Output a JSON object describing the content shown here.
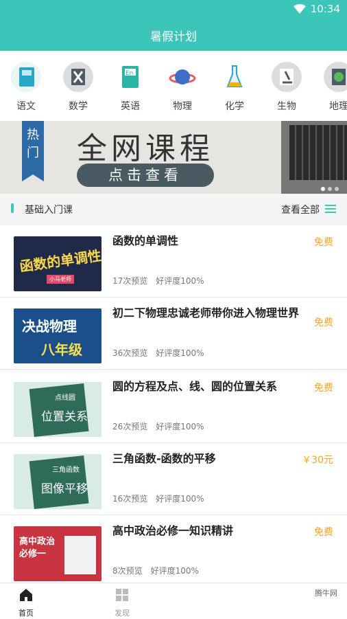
{
  "status": {
    "time": "10:34"
  },
  "header": {
    "title": "暑假计划"
  },
  "subjects": [
    {
      "label": "语文",
      "icon": "book-icon"
    },
    {
      "label": "数学",
      "icon": "math-icon"
    },
    {
      "label": "英语",
      "icon": "english-book-icon"
    },
    {
      "label": "物理",
      "icon": "planet-icon"
    },
    {
      "label": "化学",
      "icon": "flask-icon"
    },
    {
      "label": "生物",
      "icon": "microscope-icon"
    },
    {
      "label": "地理",
      "icon": "globe-icon"
    }
  ],
  "banner": {
    "tag": "热门",
    "title": "全网课程",
    "button": "点击查看"
  },
  "section": {
    "title": "基础入门课",
    "view_all": "查看全部"
  },
  "courses": [
    {
      "title": "函数的单调性",
      "price": "免费",
      "views": "17次预览",
      "rating": "好评度100%",
      "thumb_text": "函数的单调性",
      "thumb_sub": "小马老师"
    },
    {
      "title": "初二下物理忠诚老师带你进入物理世界",
      "price": "免费",
      "views": "36次预览",
      "rating": "好评度100%",
      "thumb_text": "决战物理",
      "thumb_sub": "八年级"
    },
    {
      "title": "圆的方程及点、线、圆的位置关系",
      "price": "免费",
      "views": "26次预览",
      "rating": "好评度100%",
      "thumb_text": "位置关系",
      "thumb_sub": "点线圆"
    },
    {
      "title": "三角函数-函数的平移",
      "price": "￥30元",
      "views": "16次预览",
      "rating": "好评度100%",
      "thumb_text": "图像平移",
      "thumb_sub": "三角函数"
    },
    {
      "title": "高中政治必修一知识精讲",
      "price": "免费",
      "views": "8次预览",
      "rating": "好评度100%",
      "thumb_text": "高中政治必修一",
      "thumb_sub": ""
    }
  ],
  "tabs": [
    {
      "label": "首页"
    },
    {
      "label": "发现"
    }
  ],
  "watermark": "腾牛网",
  "colors": {
    "accent": "#3cc6b9",
    "price": "#f5a523"
  }
}
